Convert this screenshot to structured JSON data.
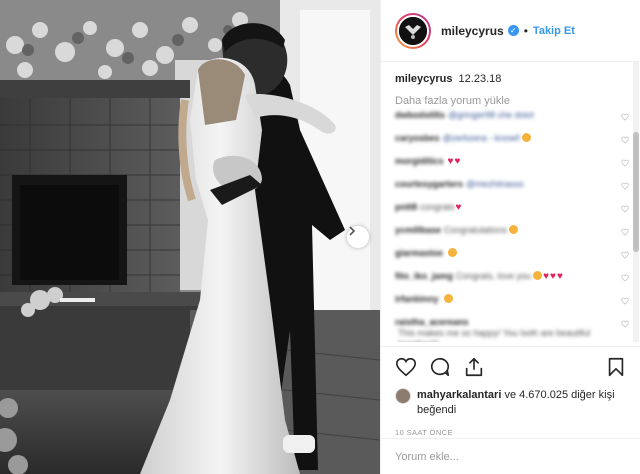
{
  "post": {
    "username": "mileycyrus",
    "verified_badge": "✓",
    "dot": "•",
    "follow_label": "Takip Et",
    "caption_user": "mileycyrus",
    "caption_text": "12.23.18",
    "load_more": "Daha fazla yorum yükle",
    "comments": [
      {
        "user": "dwbodstilts",
        "text": "@gringer98 che doiol",
        "extra": ""
      },
      {
        "user": "caryosbes",
        "text": "@zerbzera - knowl!",
        "extra": "emoji"
      },
      {
        "user": "morgiditics",
        "text": "",
        "extra": "hearts2"
      },
      {
        "user": "courtesygarters",
        "text": "@mezhitrasso",
        "extra": ""
      },
      {
        "user": "pntt8",
        "text": "congrats",
        "extra": "heart"
      },
      {
        "user": "ycmillbase",
        "text": "Congratulations",
        "extra": "emoji"
      },
      {
        "user": "giarmastoe",
        "text": "",
        "extra": "emoji"
      },
      {
        "user": "fito_iko_jamg",
        "text": "Congrats, love you",
        "extra": "hearts3"
      },
      {
        "user": "irfanbinny",
        "text": "",
        "extra": "emoji"
      },
      {
        "user": "raistha_acereans",
        "text": "This makes me so happy! You both are beautiful together!!!",
        "extra": "hearts2"
      }
    ],
    "likes_user": "mahyarkalantari",
    "likes_rest": "ve 4.670.025 diğer kişi beğendi",
    "time": "10 SAAT ÖNCE",
    "add_comment_placeholder": "Yorum ekle..."
  },
  "icons": [
    "heart-icon",
    "comment-icon",
    "share-icon",
    "bookmark-icon",
    "chevron-right-icon"
  ],
  "colors": {
    "link": "#3897f0",
    "heart": "#e0245e",
    "border": "#efefef"
  }
}
